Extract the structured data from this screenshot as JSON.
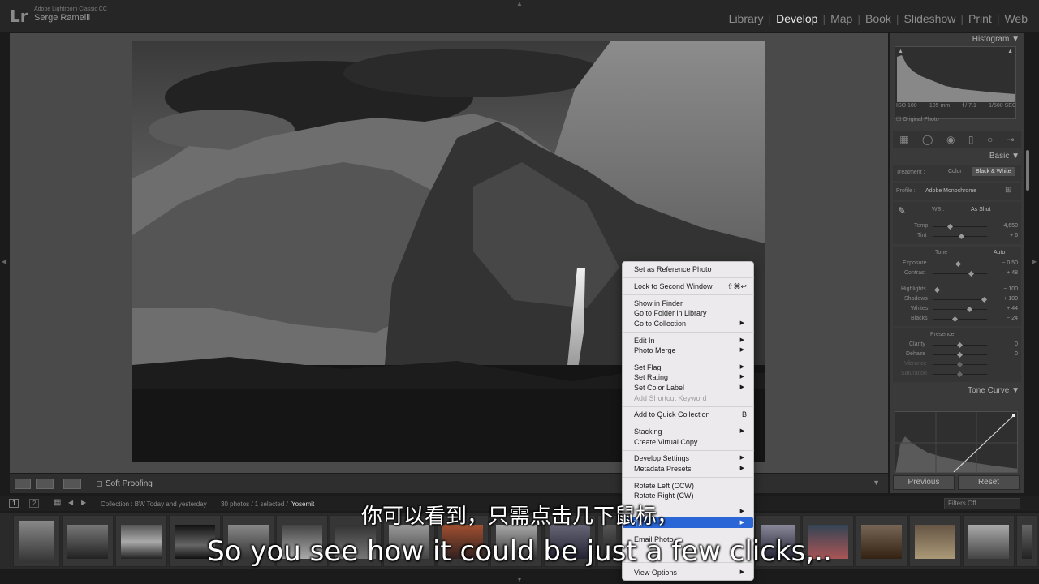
{
  "topbar": {
    "logo": "Lr",
    "app_name": "Adobe Lightroom Classic CC",
    "user_name": "Serge Ramelli",
    "modules": [
      "Library",
      "Develop",
      "Map",
      "Book",
      "Slideshow",
      "Print",
      "Web"
    ],
    "active_module": "Develop"
  },
  "toolbar": {
    "soft_proofing": "Soft Proofing"
  },
  "right_panel": {
    "histogram_title": "Histogram",
    "hist_info": [
      "ISO 100",
      "105 mm",
      "f / 7.1",
      "1/500 SEC"
    ],
    "original_photo": "Original Photo",
    "basic_title": "Basic",
    "treatment_label": "Treatment :",
    "treatment_color": "Color",
    "treatment_bw": "Black & White",
    "profile_label": "Profile :",
    "profile_value": "Adobe Monochrome",
    "wb_label": "WB :",
    "wb_value": "As Shot",
    "temp_label": "Temp",
    "temp_value": "4,650",
    "tint_label": "Tint",
    "tint_value": "+ 6",
    "tone_label": "Tone",
    "auto_label": "Auto",
    "exposure_label": "Exposure",
    "exposure_value": "− 0.50",
    "contrast_label": "Contrast",
    "contrast_value": "+ 48",
    "highlights_label": "Highlights",
    "highlights_value": "− 100",
    "shadows_label": "Shadows",
    "shadows_value": "+ 100",
    "whites_label": "Whites",
    "whites_value": "+ 44",
    "blacks_label": "Blacks",
    "blacks_value": "− 24",
    "presence_label": "Presence",
    "clarity_label": "Clarity",
    "clarity_value": "0",
    "dehaze_label": "Dehaze",
    "dehaze_value": "0",
    "vibrance_label": "Vibrance",
    "saturation_label": "Saturation",
    "tone_curve_title": "Tone Curve",
    "previous_label": "Previous",
    "reset_label": "Reset"
  },
  "filmbar": {
    "page1": "1",
    "page2": "2",
    "collection": "Collection : BW Today and yesterday",
    "count": "30 photos / 1 selected /",
    "filename": "Yosemit",
    "filters": "Filters Off"
  },
  "context_menu": {
    "items": [
      "Set as Reference Photo",
      "Lock to Second Window",
      "Show in Finder",
      "Go to Folder in Library",
      "Go to Collection",
      "Edit In",
      "Photo Merge",
      "Set Flag",
      "Set Rating",
      "Set Color Label",
      "Add Shortcut Keyword",
      "Add to Quick Collection",
      "Stacking",
      "Create Virtual Copy",
      "Develop Settings",
      "Metadata Presets",
      "Rotate Left (CCW)",
      "Rotate Right (CW)",
      "Th",
      "Email Photo...",
      "View Options"
    ],
    "lock_shortcut": "⇧⌘↩",
    "quick_collection_shortcut": "B"
  },
  "subtitles": {
    "zh": "你可以看到，只需点击几下鼠标，",
    "en": "So you see how it could be just a few clicks,.."
  }
}
